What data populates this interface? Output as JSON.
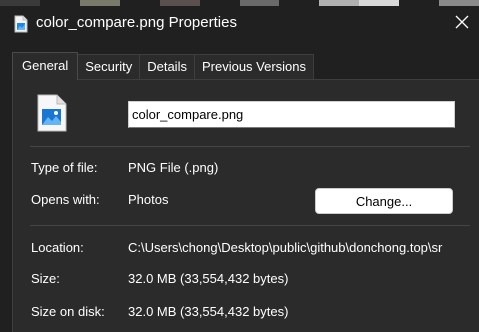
{
  "window": {
    "title": "color_compare.png Properties"
  },
  "tabs": [
    {
      "label": "General",
      "active": true
    },
    {
      "label": "Security",
      "active": false
    },
    {
      "label": "Details",
      "active": false
    },
    {
      "label": "Previous Versions",
      "active": false
    }
  ],
  "general": {
    "file_name": "color_compare.png",
    "type_of_file_label": "Type of file:",
    "type_of_file_value": "PNG File (.png)",
    "opens_with_label": "Opens with:",
    "opens_with_value": "Photos",
    "change_button_label": "Change...",
    "location_label": "Location:",
    "location_value": "C:\\Users\\chong\\Desktop\\public\\github\\donchong.top\\sr",
    "size_label": "Size:",
    "size_value": "32.0 MB (33,554,432 bytes)",
    "size_on_disk_label": "Size on disk:",
    "size_on_disk_value": "32.0 MB (33,554,432 bytes)"
  },
  "icons": {
    "title_icon": "image-file-icon",
    "file_icon": "image-file-icon",
    "close": "close-icon"
  },
  "colors": {
    "window_bg": "#202020",
    "panel_bg": "#2b2b2b",
    "accent_blue": "#1e88e5"
  }
}
